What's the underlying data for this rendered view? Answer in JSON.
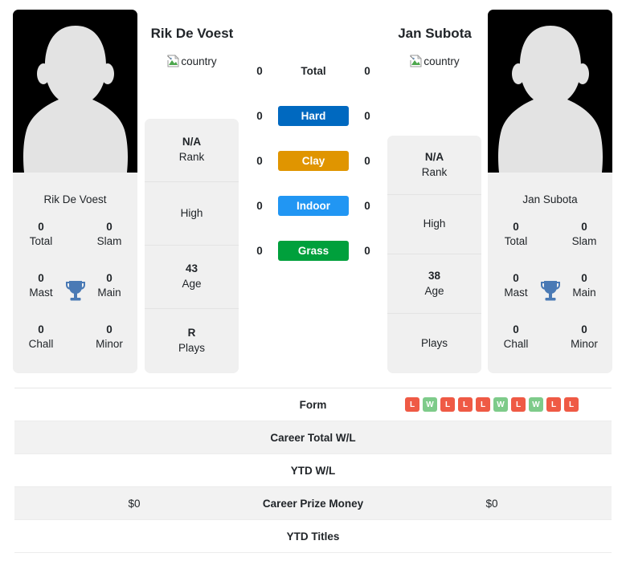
{
  "players": {
    "left": {
      "name": "Rik De Voest",
      "country_alt": "country",
      "photo_caption": "Rik De Voest",
      "titles": [
        {
          "value": "0",
          "label": "Total"
        },
        {
          "value": "0",
          "label": "Slam"
        },
        {
          "value": "0",
          "label": "Mast"
        },
        {
          "value": "0",
          "label": "Main"
        },
        {
          "value": "0",
          "label": "Chall"
        },
        {
          "value": "0",
          "label": "Minor"
        }
      ],
      "info": [
        {
          "value": "N/A",
          "label": "Rank"
        },
        {
          "value": "",
          "label": "High"
        },
        {
          "value": "43",
          "label": "Age"
        },
        {
          "value": "R",
          "label": "Plays"
        }
      ]
    },
    "right": {
      "name": "Jan Subota",
      "country_alt": "country",
      "photo_caption": "Jan Subota",
      "titles": [
        {
          "value": "0",
          "label": "Total"
        },
        {
          "value": "0",
          "label": "Slam"
        },
        {
          "value": "0",
          "label": "Mast"
        },
        {
          "value": "0",
          "label": "Main"
        },
        {
          "value": "0",
          "label": "Chall"
        },
        {
          "value": "0",
          "label": "Minor"
        }
      ],
      "info": [
        {
          "value": "N/A",
          "label": "Rank"
        },
        {
          "value": "",
          "label": "High"
        },
        {
          "value": "38",
          "label": "Age"
        },
        {
          "value": "",
          "label": "Plays"
        }
      ]
    }
  },
  "surfaces": [
    {
      "label": "Total",
      "left": "0",
      "right": "0",
      "color": "",
      "plain": true
    },
    {
      "label": "Hard",
      "left": "0",
      "right": "0",
      "color": "#0069c0",
      "plain": false
    },
    {
      "label": "Clay",
      "left": "0",
      "right": "0",
      "color": "#e09500",
      "plain": false
    },
    {
      "label": "Indoor",
      "left": "0",
      "right": "0",
      "color": "#2196f3",
      "plain": false
    },
    {
      "label": "Grass",
      "left": "0",
      "right": "0",
      "color": "#00a03c",
      "plain": false
    }
  ],
  "table": [
    {
      "label": "Form",
      "type": "form",
      "left_form": [],
      "right_form": [
        "L",
        "W",
        "L",
        "L",
        "L",
        "W",
        "L",
        "W",
        "L",
        "L"
      ],
      "alt": false
    },
    {
      "label": "Career Total W/L",
      "type": "text",
      "left": "",
      "right": "",
      "alt": true
    },
    {
      "label": "YTD W/L",
      "type": "text",
      "left": "",
      "right": "",
      "alt": false
    },
    {
      "label": "Career Prize Money",
      "type": "text",
      "left": "$0",
      "right": "$0",
      "alt": true
    },
    {
      "label": "YTD Titles",
      "type": "text",
      "left": "",
      "right": "",
      "alt": false
    }
  ],
  "colors": {
    "hard": "#0069c0",
    "clay": "#e09500",
    "indoor": "#2196f3",
    "grass": "#00a03c",
    "win_badge": "#7ecb8a",
    "loss_badge": "#ef5a45",
    "card_bg": "#f0f0f0",
    "row_alt_bg": "#f2f2f2"
  }
}
